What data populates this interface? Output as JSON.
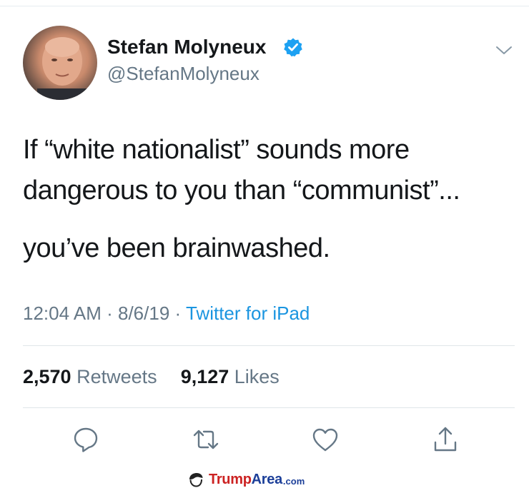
{
  "tweet": {
    "display_name": "Stefan Molyneux",
    "handle": "@StefanMolyneux",
    "verified": true,
    "text_line_1": "If “white nationalist” sounds more dangerous to you than “communist”...",
    "text_line_2": "you’ve been brainwashed.",
    "time": "12:04 AM",
    "date": "8/6/19",
    "separator": "·",
    "source": "Twitter for iPad",
    "retweets_count": "2,570",
    "retweets_label": "Retweets",
    "likes_count": "9,127",
    "likes_label": "Likes"
  },
  "icons": {
    "verified": "verified-badge-icon",
    "menu": "chevron-down-icon",
    "reply": "reply-icon",
    "retweet": "retweet-icon",
    "like": "heart-icon",
    "share": "share-icon"
  },
  "watermark": {
    "brand_1": "Trump",
    "brand_2": "Area",
    "tld": ".com"
  },
  "colors": {
    "text": "#14171a",
    "secondary": "#657786",
    "link": "#1b95e0",
    "verified": "#1da1f2",
    "divider": "#dfe5e9"
  }
}
